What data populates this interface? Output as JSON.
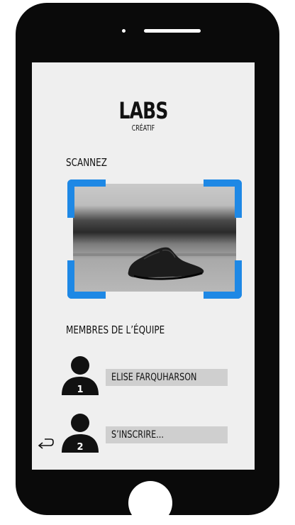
{
  "app": {
    "logo_title": "LABS",
    "logo_subtitle": "CRÉATIF"
  },
  "scan": {
    "label": "SCANNEZ",
    "frame_color": "#1e88e5",
    "image_subject": "black shoe"
  },
  "team": {
    "label": "MEMBRES DE L’ÉQUIPE",
    "members": [
      {
        "badge": "1",
        "name": "ELISE FARQUHARSON"
      },
      {
        "badge": "2",
        "name": "S’INSCRIRE..."
      }
    ]
  },
  "icons": {
    "avatar": "person-icon",
    "return": "return-arrow-icon",
    "scroll_up": "chevron-up-icon",
    "scroll_down": "chevron-down-icon"
  }
}
